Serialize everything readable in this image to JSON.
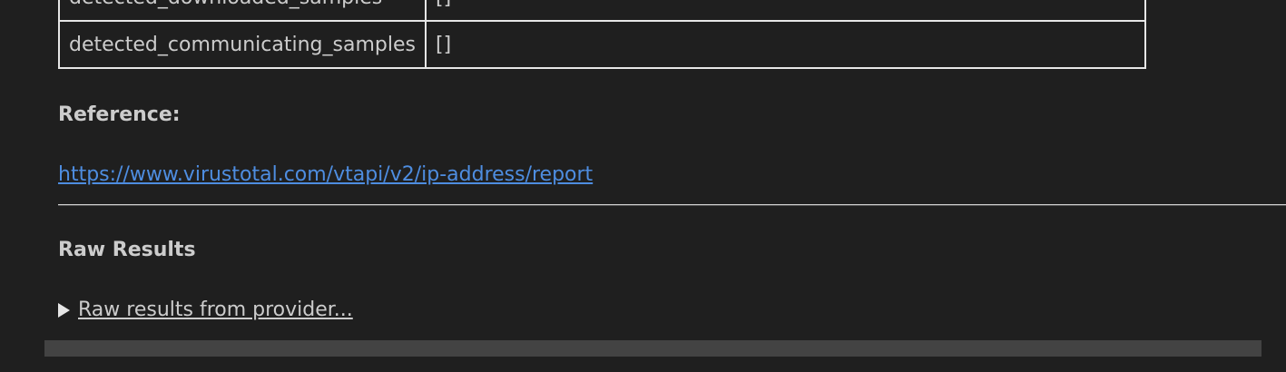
{
  "table": {
    "rows": [
      {
        "key": "detected_downloaded_samples",
        "value": "[]"
      },
      {
        "key": "detected_communicating_samples",
        "value": "[]"
      }
    ]
  },
  "reference": {
    "label": "Reference:",
    "url": "https://www.virustotal.com/vtapi/v2/ip-address/report"
  },
  "raw_results": {
    "heading": "Raw Results",
    "summary": "Raw results from provider..."
  },
  "colors": {
    "background": "#1f1f1f",
    "text": "#cccccc",
    "link": "#4e8de0",
    "border": "#e6e6e6",
    "scrollbar": "#434343"
  }
}
